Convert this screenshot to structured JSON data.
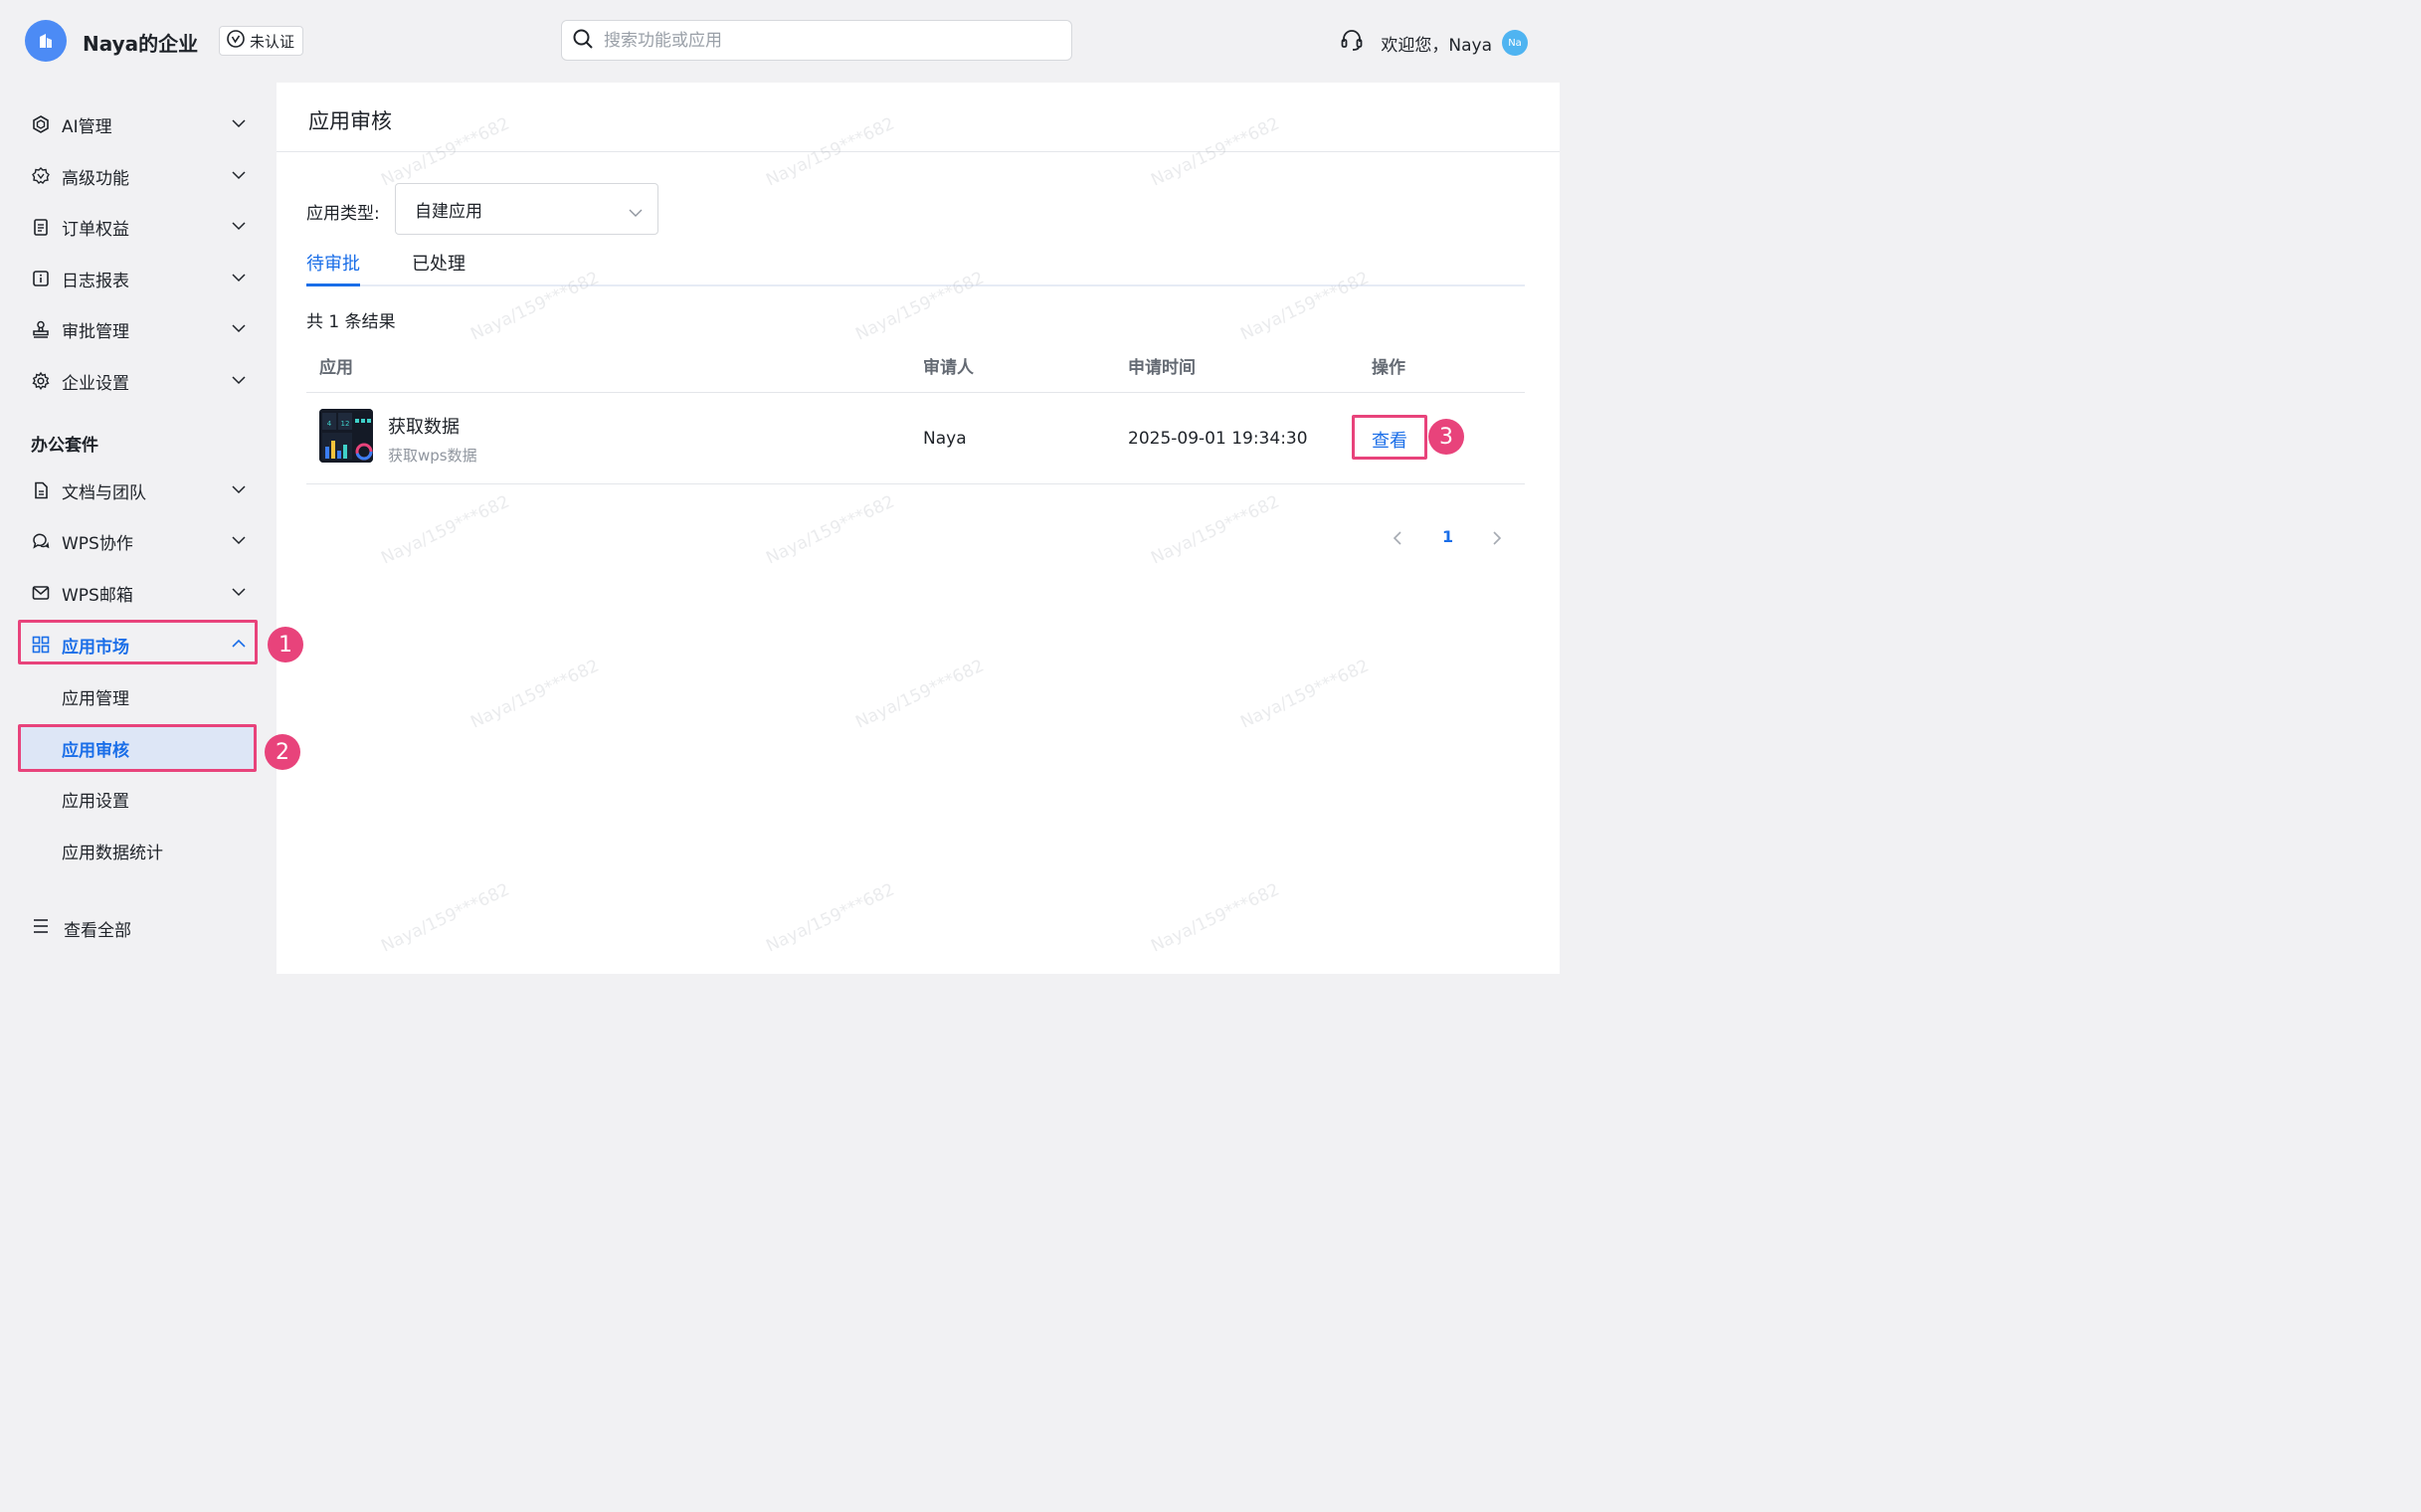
{
  "header": {
    "org_name": "Naya的企业",
    "cert_label": "未认证",
    "search_placeholder": "搜索功能或应用",
    "welcome": "欢迎您，Naya",
    "avatar_text": "Na"
  },
  "sidebar": {
    "items": [
      {
        "label": "AI管理",
        "icon": "ai-hexagon-icon"
      },
      {
        "label": "高级功能",
        "icon": "premium-badge-icon"
      },
      {
        "label": "订单权益",
        "icon": "clipboard-icon"
      },
      {
        "label": "日志报表",
        "icon": "info-document-icon"
      },
      {
        "label": "审批管理",
        "icon": "stamp-icon"
      },
      {
        "label": "企业设置",
        "icon": "gear-icon"
      }
    ],
    "section_title": "办公套件",
    "office_items": [
      {
        "label": "文档与团队",
        "icon": "document-icon"
      },
      {
        "label": "WPS协作",
        "icon": "chat-bubble-icon"
      },
      {
        "label": "WPS邮箱",
        "icon": "mail-icon"
      },
      {
        "label": "应用市场",
        "icon": "app-grid-icon"
      }
    ],
    "sub_items": [
      "应用管理",
      "应用审核",
      "应用设置",
      "应用数据统计"
    ],
    "view_all": "查看全部"
  },
  "steps": [
    "1",
    "2",
    "3"
  ],
  "main": {
    "title": "应用审核",
    "filter_label": "应用类型:",
    "filter_value": "自建应用",
    "tabs": [
      "待审批",
      "已处理"
    ],
    "result_count": "共 1 条结果",
    "columns": [
      "应用",
      "审请人",
      "申请时间",
      "操作"
    ],
    "rows": [
      {
        "app_name": "获取数据",
        "app_desc": "获取wps数据",
        "applicant": "Naya",
        "time": "2025-09-01 19:34:30",
        "action": "查看"
      }
    ],
    "pager": {
      "current": "1"
    }
  },
  "watermark_text": "Naya/159***682",
  "colors": {
    "accent": "#1a6ee8",
    "highlight": "#e8437b",
    "logo": "#4c8bf5"
  }
}
